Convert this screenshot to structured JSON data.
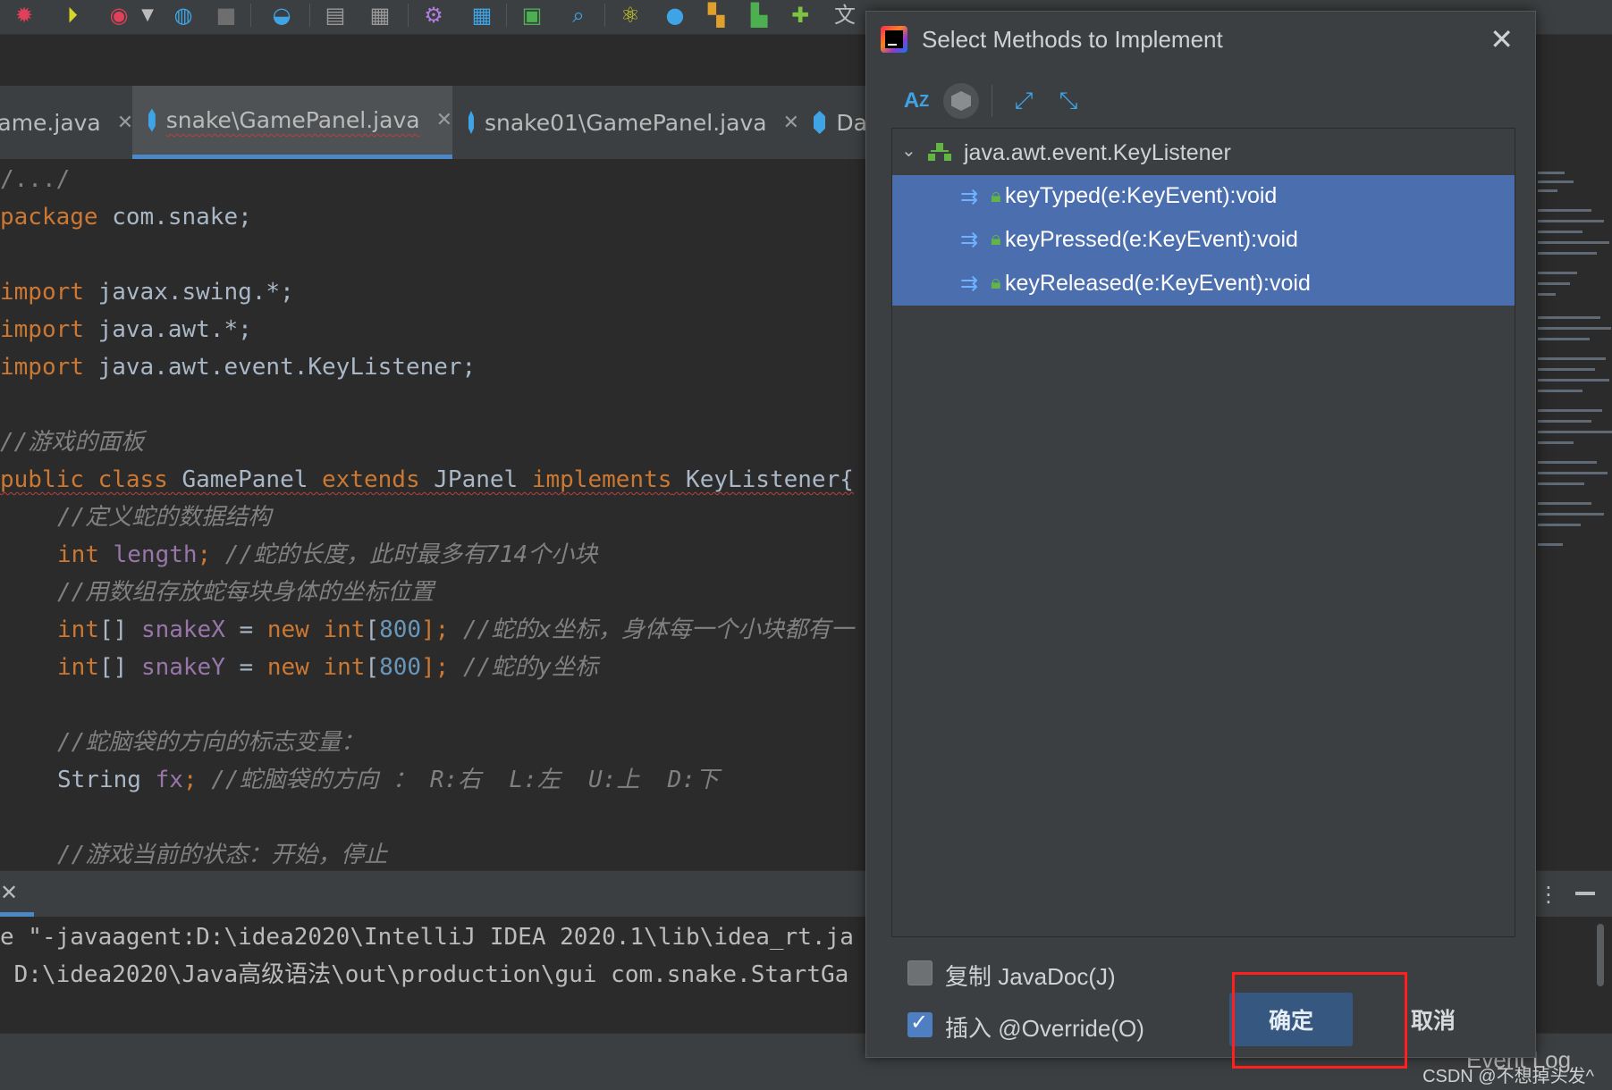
{
  "toolbar": {
    "icons": [
      "debug-icon",
      "run-coverage-icon",
      "profiler-icon",
      "dropdown-icon",
      "update-icon",
      "stop-icon",
      "sync-icon",
      "build-icon",
      "deploy-icon",
      "settings-icon",
      "structure-icon",
      "terminal-icon",
      "search-icon",
      "react-icon",
      "point-icon",
      "layout-icon",
      "chart-icon",
      "plugin-icon",
      "translate-icon"
    ]
  },
  "tabs": [
    {
      "label": "Game.java",
      "active": false
    },
    {
      "label": "snake\\GamePanel.java",
      "active": true
    },
    {
      "label": "snake01\\GamePanel.java",
      "active": false
    },
    {
      "label": "Da",
      "active": false
    }
  ],
  "editor": {
    "lines": {
      "l1": "/.../",
      "l2_kw": "package",
      "l2_rest": " com.snake;",
      "l3_kw": "import",
      "l3_rest": " javax.swing.*;",
      "l4_kw": "import",
      "l4_rest": " java.awt.*;",
      "l5_kw": "import",
      "l5_rest": " java.awt.event.KeyListener;",
      "l6": "//游戏的面板",
      "l7_a": "public class",
      "l7_b": " GamePanel ",
      "l7_c": "extends",
      "l7_d": " JPanel ",
      "l7_e": "implements",
      "l7_f": " KeyListener{",
      "l8": "//定义蛇的数据结构",
      "l9_a": "int",
      "l9_b": " length",
      "l9_c": ";",
      "l9_d": " //蛇的长度，此时最多有714个小块",
      "l10": "//用数组存放蛇每块身体的坐标位置",
      "l11_a": "int",
      "l11_b": "[] ",
      "l11_c": "snakeX",
      "l11_d": " = ",
      "l11_e": "new int",
      "l11_f": "[",
      "l11_g": "800",
      "l11_h": "];",
      "l11_i": " //蛇的x坐标，身体每一个小块都有一",
      "l12_a": "int",
      "l12_b": "[] ",
      "l12_c": "snakeY",
      "l12_d": " = ",
      "l12_e": "new int",
      "l12_f": "[",
      "l12_g": "800",
      "l12_h": "];",
      "l12_i": " //蛇的y坐标",
      "l13": "//蛇脑袋的方向的标志变量：",
      "l14_a": "String ",
      "l14_b": "fx",
      "l14_c": ";",
      "l14_d": " //蛇脑袋的方向 ： R:右  L:左  U:上  D:下",
      "l15": "//游戏当前的状态：开始，停止"
    }
  },
  "run": {
    "output": [
      "e \"-javaagent:D:\\idea2020\\IntelliJ IDEA 2020.1\\lib\\idea_rt.ja",
      " D:\\idea2020\\Java高级语法\\out\\production\\gui com.snake.StartGa"
    ]
  },
  "status": {
    "event_log": "Event Log"
  },
  "dialog": {
    "title": "Select Methods to Implement",
    "tree": {
      "interface": "java.awt.event.KeyListener",
      "methods": [
        "keyTyped(e:KeyEvent):void",
        "keyPressed(e:KeyEvent):void",
        "keyReleased(e:KeyEvent):void"
      ]
    },
    "options": {
      "copy_javadoc": {
        "label": "复制 JavaDoc(J)",
        "checked": false
      },
      "insert_override": {
        "label": "插入 @Override(O)",
        "checked": true
      }
    },
    "ok_label": "确定",
    "cancel_label": "取消"
  },
  "watermark": "CSDN @不想掉头发^",
  "colors": {
    "selection": "#4b6eaf",
    "highlight_box": "#ff1f1f",
    "keyword": "#cc7832",
    "comment": "#808080",
    "field": "#9876aa"
  }
}
